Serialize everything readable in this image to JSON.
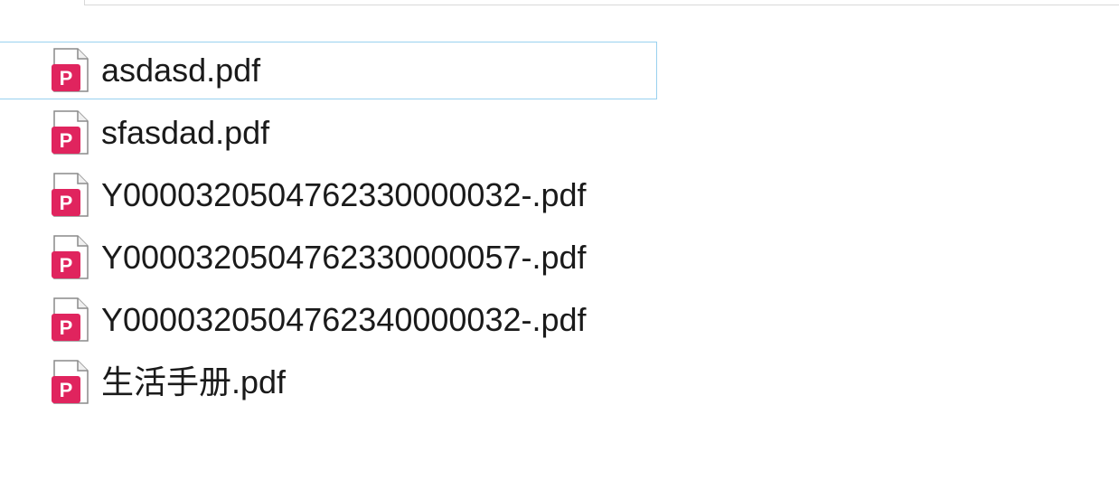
{
  "files": [
    {
      "name": "asdasd.pdf",
      "icon": "pdf-file-icon",
      "selected": true
    },
    {
      "name": "sfasdad.pdf",
      "icon": "pdf-file-icon",
      "selected": false
    },
    {
      "name": "Y0000320504762330000032-.pdf",
      "icon": "pdf-file-icon",
      "selected": false
    },
    {
      "name": "Y0000320504762330000057-.pdf",
      "icon": "pdf-file-icon",
      "selected": false
    },
    {
      "name": "Y0000320504762340000032-.pdf",
      "icon": "pdf-file-icon",
      "selected": false
    },
    {
      "name": "生活手册.pdf",
      "icon": "pdf-file-icon",
      "selected": false
    }
  ],
  "colors": {
    "pdf_icon": "#e0245e",
    "selection_border": "#99d1ef"
  }
}
